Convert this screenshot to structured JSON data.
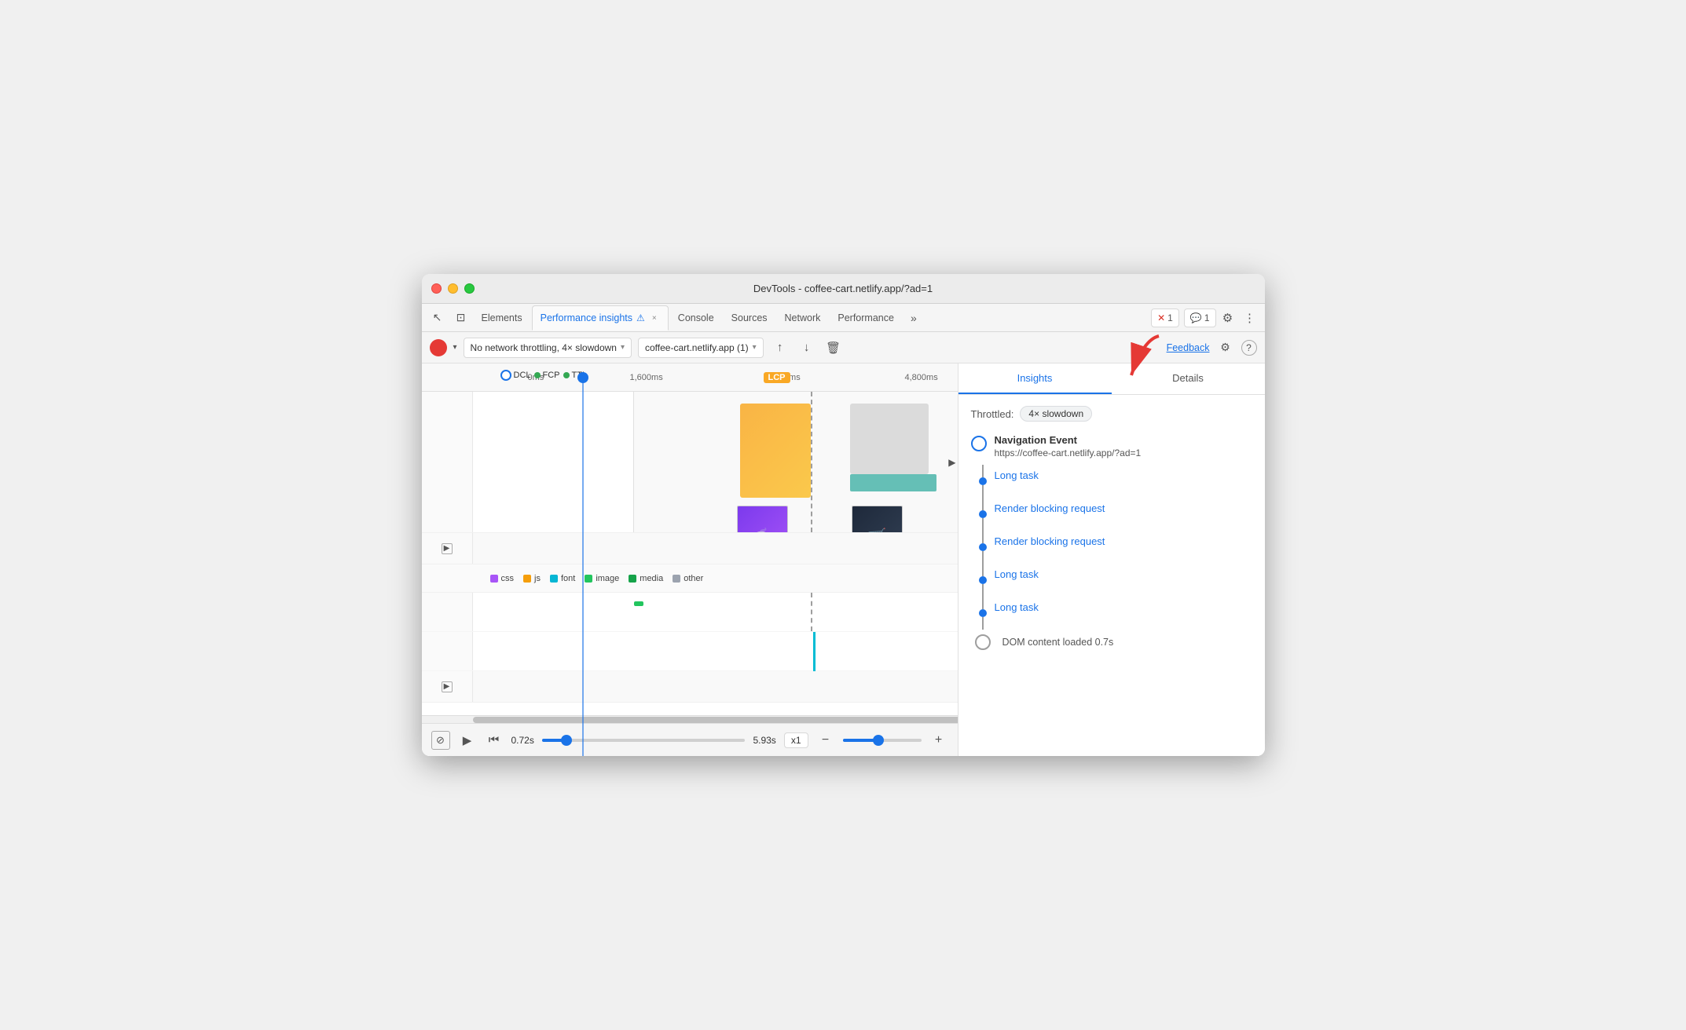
{
  "window": {
    "title": "DevTools - coffee-cart.netlify.app/?ad=1"
  },
  "tabs": {
    "items": [
      {
        "label": "Elements",
        "active": false,
        "closeable": false
      },
      {
        "label": "Performance insights",
        "active": true,
        "closeable": true,
        "warning": true
      },
      {
        "label": "Console",
        "active": false,
        "closeable": false
      },
      {
        "label": "Sources",
        "active": false,
        "closeable": false
      },
      {
        "label": "Network",
        "active": false,
        "closeable": false
      },
      {
        "label": "Performance",
        "active": false,
        "closeable": false
      }
    ],
    "more_label": "»",
    "error_badge": "1",
    "comment_badge": "1"
  },
  "toolbar": {
    "throttle_label": "No network throttling, 4× slowdown",
    "url_label": "coffee-cart.netlify.app (1)",
    "feedback_label": "Feedback"
  },
  "timeline": {
    "times": [
      "0ms",
      "1,600ms",
      "3,200ms",
      "4,800ms"
    ],
    "metrics": {
      "dcl": "DCL",
      "fcp": "FCP",
      "tti": "TTI",
      "lcp": "LCP"
    }
  },
  "legend": {
    "items": [
      "css",
      "js",
      "font",
      "image",
      "media",
      "other"
    ]
  },
  "playback": {
    "start_time": "0.72s",
    "end_time": "5.93s",
    "speed": "x1"
  },
  "insights_panel": {
    "tabs": [
      "Insights",
      "Details"
    ],
    "active_tab": "Insights",
    "throttle_label": "Throttled:",
    "throttle_value": "4× slowdown",
    "nav_event": {
      "title": "Navigation Event",
      "url": "https://coffee-cart.netlify.app/?ad=1"
    },
    "items": [
      {
        "type": "link",
        "label": "Long task"
      },
      {
        "type": "link",
        "label": "Render blocking request"
      },
      {
        "type": "link",
        "label": "Render blocking request"
      },
      {
        "type": "link",
        "label": "Long task"
      },
      {
        "type": "link",
        "label": "Long task"
      },
      {
        "type": "dom",
        "label": "DOM content loaded  0.7s"
      }
    ]
  },
  "icons": {
    "cursor": "↖",
    "layers": "▣",
    "record": "●",
    "dropdown": "▾",
    "export_up": "↑",
    "download": "↓",
    "delete": "🗑",
    "gear": "⚙",
    "help": "?",
    "play": "▶",
    "skip": "⏭",
    "zoom_in": "+",
    "zoom_out": "−",
    "more": "⋮",
    "expand": "▶",
    "close": "×",
    "camera_off": "⊘"
  }
}
